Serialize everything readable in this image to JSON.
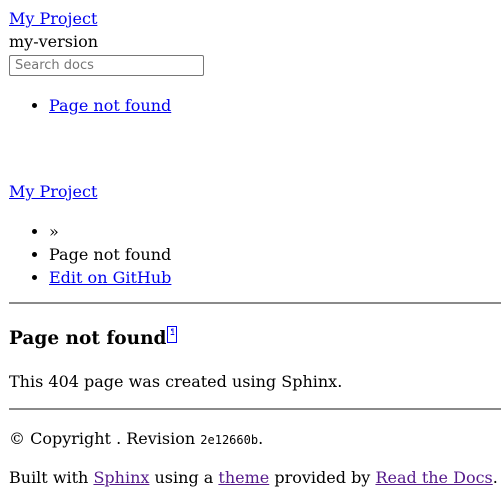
{
  "sidebar": {
    "project_link": "My Project",
    "version": "my-version",
    "search_placeholder": "Search docs",
    "menu": [
      {
        "label": "Page not found"
      }
    ]
  },
  "header": {
    "project_link": "My Project"
  },
  "breadcrumbs": {
    "home_sep": "»",
    "current": "Page not found",
    "edit_link": "Edit on GitHub"
  },
  "content": {
    "title": "Page not found",
    "permalink_glyph": "¶",
    "body": "This 404 page was created using Sphinx."
  },
  "footer": {
    "copyright_text": "© Copyright . Revision",
    "revision": "2e12660b",
    "revision_suffix": ".",
    "built_prefix": "Built with",
    "sphinx_link": "Sphinx",
    "using_text": "using a",
    "theme_link": "theme",
    "provided_text": "provided by",
    "rtd_link": "Read the Docs",
    "end_period": "."
  }
}
